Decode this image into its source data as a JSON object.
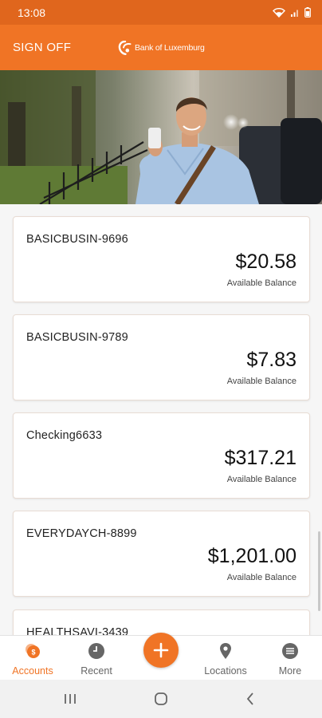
{
  "status_bar": {
    "time": "13:08",
    "icons": [
      "wifi-icon",
      "signal-icon",
      "battery-icon"
    ]
  },
  "header": {
    "sign_off_label": "SIGN OFF",
    "logo_text": "Bank of Luxemburg"
  },
  "accounts": [
    {
      "name": "BASICBUSIN-9696",
      "balance": "$20.58",
      "balance_label": "Available Balance"
    },
    {
      "name": "BASICBUSIN-9789",
      "balance": "$7.83",
      "balance_label": "Available Balance"
    },
    {
      "name": "Checking6633",
      "balance": "$317.21",
      "balance_label": "Available Balance"
    },
    {
      "name": "EVERYDAYCH-8899",
      "balance": "$1,201.00",
      "balance_label": "Available Balance"
    },
    {
      "name": "HEALTHSAVI-3439",
      "balance": "",
      "balance_label": ""
    }
  ],
  "bottom_nav": {
    "items": [
      {
        "label": "Accounts",
        "icon": "accounts-coin-icon",
        "active": true
      },
      {
        "label": "Recent",
        "icon": "clock-icon",
        "active": false
      },
      {
        "label": "",
        "icon": "plus-icon",
        "active": false
      },
      {
        "label": "Locations",
        "icon": "location-pin-icon",
        "active": false
      },
      {
        "label": "More",
        "icon": "menu-lines-icon",
        "active": false
      }
    ]
  },
  "colors": {
    "brand": "#f07425",
    "status_bar": "#e0661d",
    "card_border": "#e8dcd4"
  },
  "android_nav": {
    "icons": [
      "recents-icon",
      "home-icon",
      "back-icon"
    ]
  }
}
